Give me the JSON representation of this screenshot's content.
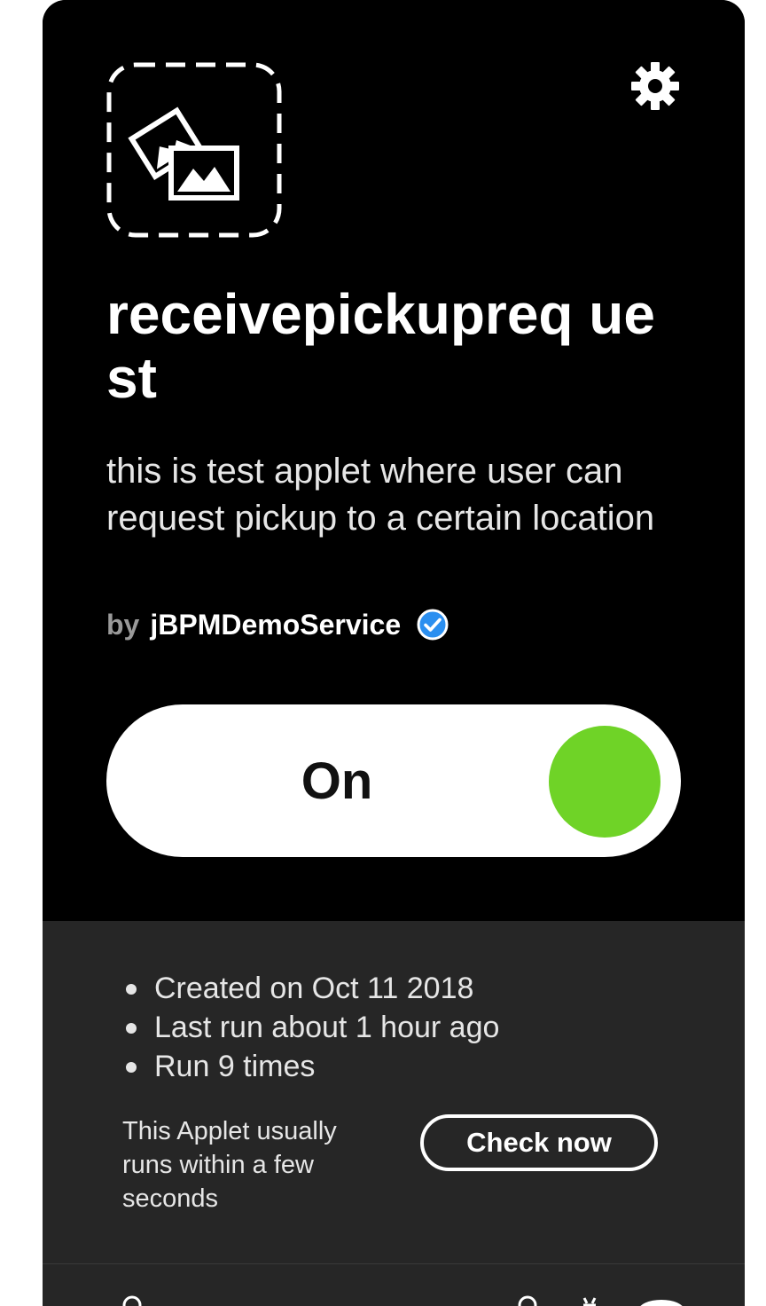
{
  "applet": {
    "title": "receivepickupreq uest",
    "description": "this is test applet where user can request pickup to a certain location",
    "by_label": "by",
    "author": "jBPMDemoService"
  },
  "toggle": {
    "label": "On",
    "state": "on",
    "knob_color": "#6fd327"
  },
  "stats": {
    "created": "Created on Oct 11 2018",
    "last_run": "Last run about 1 hour ago",
    "run_count": "Run 9 times"
  },
  "run_note": "This Applet usually runs within a few seconds",
  "check_button": "Check now",
  "icons": {
    "applet": "image-gallery-icon",
    "settings": "gear-icon",
    "verified": "verified-check-icon"
  },
  "colors": {
    "card": "#000000",
    "info_panel": "#262626",
    "verified": "#2b8ff0"
  }
}
